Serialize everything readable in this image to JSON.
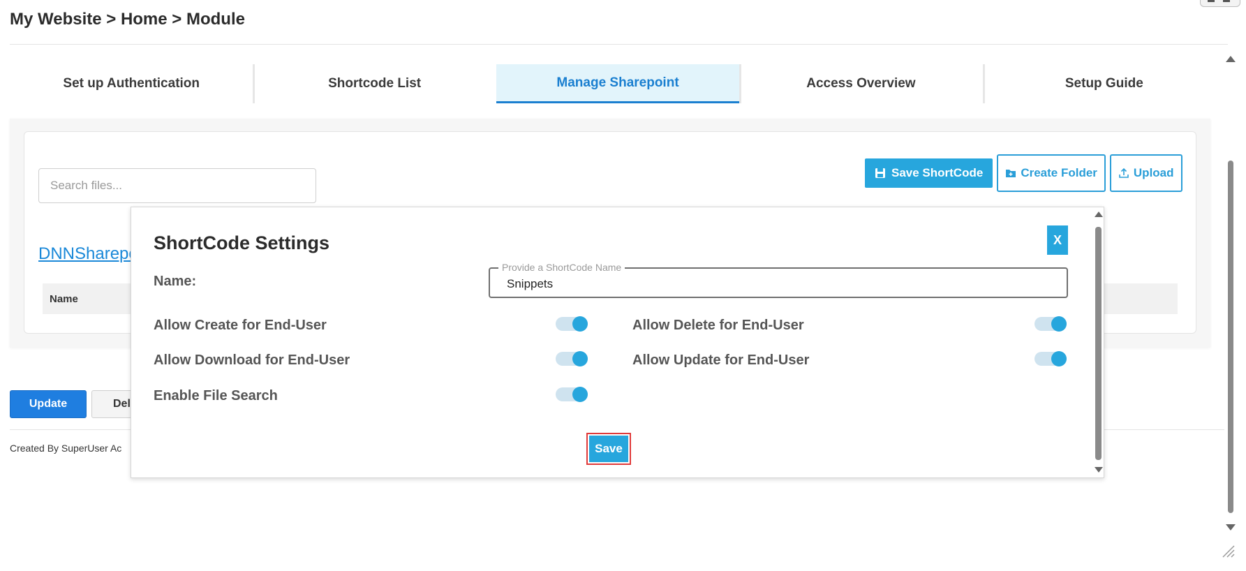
{
  "breadcrumb": "My Website > Home > Module",
  "tabs": [
    {
      "label": "Set up Authentication"
    },
    {
      "label": "Shortcode List"
    },
    {
      "label": "Manage Sharepoint"
    },
    {
      "label": "Access Overview"
    },
    {
      "label": "Setup Guide"
    }
  ],
  "search": {
    "placeholder": "Search files...",
    "value": ""
  },
  "toolbar": {
    "save_shortcode": "Save ShortCode",
    "create_folder": "Create Folder",
    "upload": "Upload"
  },
  "folder_link": "DNNSharepo",
  "table": {
    "headers": [
      "Name"
    ]
  },
  "actions": {
    "update": "Update",
    "delete": "Del"
  },
  "footer": "Created By SuperUser Ac",
  "modal": {
    "title": "ShortCode Settings",
    "close": "X",
    "name_label": "Name:",
    "name_legend": "Provide a ShortCode Name",
    "name_value": "Snippets",
    "options": [
      {
        "label": "Allow Create for End-User",
        "enabled": true
      },
      {
        "label": "Allow Delete for End-User",
        "enabled": true
      },
      {
        "label": "Allow Download for End-User",
        "enabled": true
      },
      {
        "label": "Allow Update for End-User",
        "enabled": true
      },
      {
        "label": "Enable File Search",
        "enabled": true
      }
    ],
    "save": "Save"
  },
  "colors": {
    "accent": "#27a6dd",
    "active_tab_text": "#1a7fd0",
    "update_button": "#1f7ee0",
    "highlight_border": "#e03a3a"
  }
}
